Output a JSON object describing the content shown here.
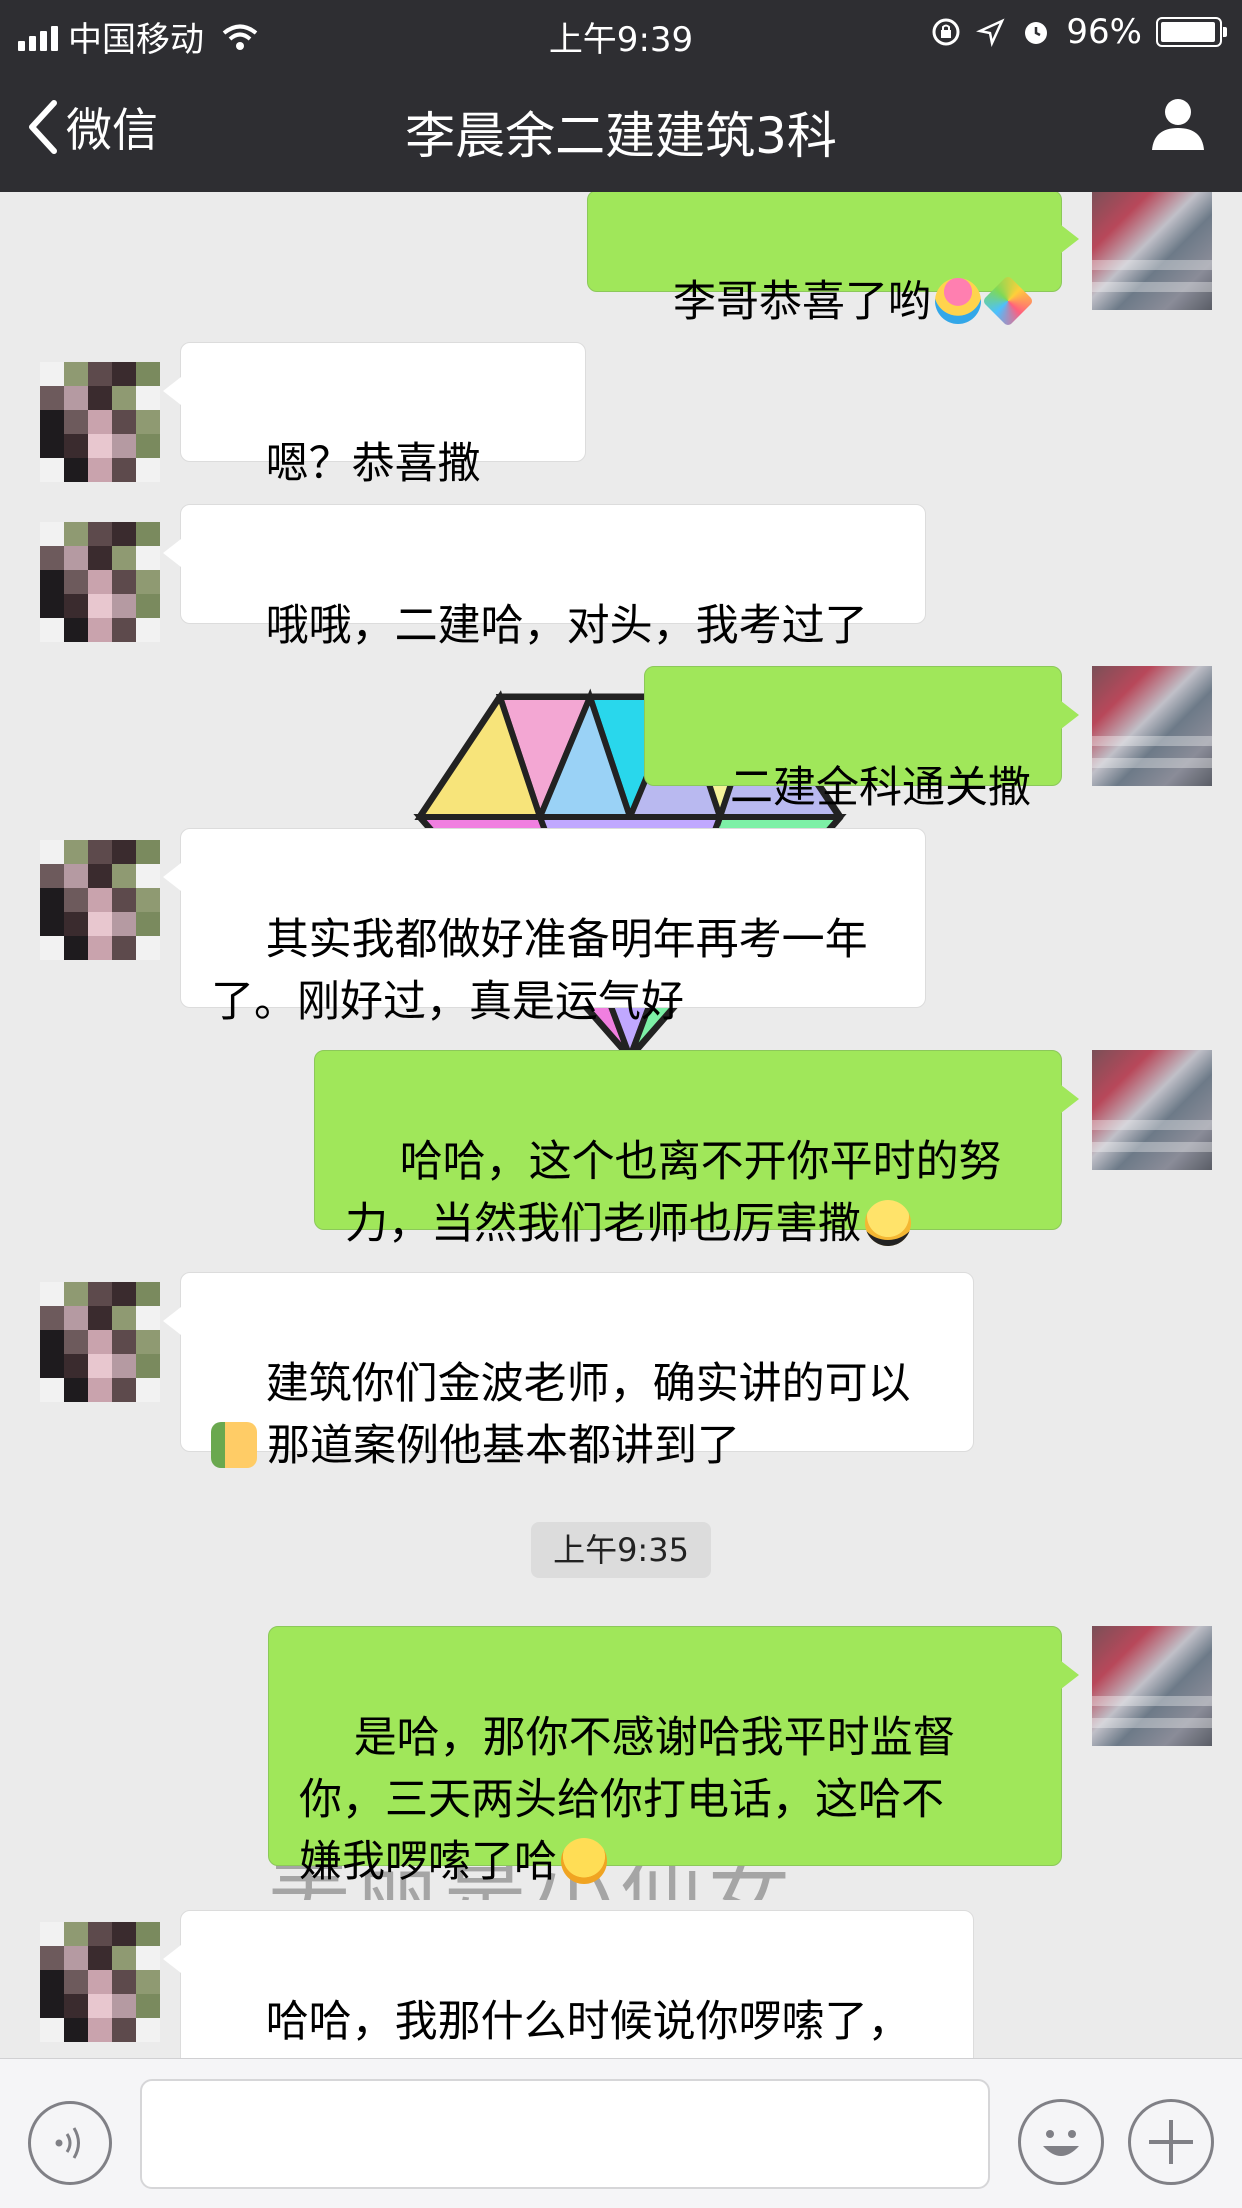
{
  "status_bar": {
    "carrier": "中国移动",
    "time": "上午9:39",
    "battery": "96%",
    "battery_level": 0.96,
    "icons": [
      "signal-icon",
      "wifi-icon",
      "rotation-lock-icon",
      "location-icon",
      "alarm-icon",
      "battery-icon"
    ]
  },
  "nav": {
    "back_label": "微信",
    "title": "李晨余二建建筑3科",
    "profile_icon": "person-icon"
  },
  "background": {
    "watermark_caption": "美丽是小仙女"
  },
  "messages": [
    {
      "sender": "me",
      "text": "李哥恭喜了哟",
      "emoji": [
        "shaved-ice-emoji",
        "party-popper-emoji"
      ]
    },
    {
      "sender": "other",
      "text": "嗯？恭喜撒子？"
    },
    {
      "sender": "other",
      "text": "哦哦，二建哈，对头，我考过了"
    },
    {
      "sender": "me",
      "text": "二建全科通关撒"
    },
    {
      "sender": "other",
      "text": "其实我都做好准备明年再考一年\n了。刚好过，真是运气好"
    },
    {
      "sender": "me",
      "text": "哈哈，这个也离不开你平时的努\n力，当然我们老师也厉害撒",
      "emoji": [
        "sunglasses-emoji"
      ]
    },
    {
      "sender": "other",
      "text": "建筑你们金波老师，确实讲的可以\n那道案例他基本都讲到了",
      "emoji_leading": "thumbs-up-emoji"
    },
    {
      "sender": "me",
      "text": "是哈，那你不感谢哈我平时监督\n你，三天两头给你打电话，这哈不\n嫌我啰嗦了哈",
      "emoji": [
        "thinking-emoji"
      ]
    },
    {
      "sender": "other",
      "text": "哈哈，我那什么时候说你啰嗦了，\n还是谢谢小赵老师监督"
    }
  ],
  "timestamp": "上午9:35",
  "input_bar": {
    "voice_icon": "voice-icon",
    "emoji_icon": "smiley-icon",
    "plus_icon": "plus-icon",
    "input_value": ""
  }
}
